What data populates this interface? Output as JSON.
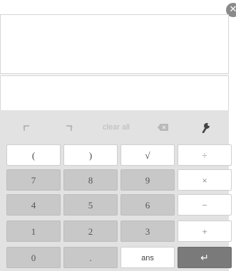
{
  "window": {
    "close_glyph": "✕"
  },
  "display": {
    "expression": "",
    "input": ""
  },
  "toolbar": {
    "undo_icon": "undo-icon",
    "redo_icon": "redo-icon",
    "clear_all_label": "clear all",
    "backspace_icon": "backspace-icon",
    "settings_icon": "wrench-icon"
  },
  "keypad": {
    "rows": [
      [
        "(",
        ")",
        "√",
        "÷"
      ],
      [
        "7",
        "8",
        "9",
        "×"
      ],
      [
        "4",
        "5",
        "6",
        "−"
      ],
      [
        "1",
        "2",
        "3",
        "+"
      ],
      [
        "0",
        ".",
        "ans",
        "↵"
      ]
    ]
  },
  "colors": {
    "key_gray": "#c8c8c8",
    "key_white": "#ffffff",
    "enter_key": "#7a7a7a",
    "keypad_background": "#e2e2e2",
    "icon_color": "#b9b9b9"
  }
}
